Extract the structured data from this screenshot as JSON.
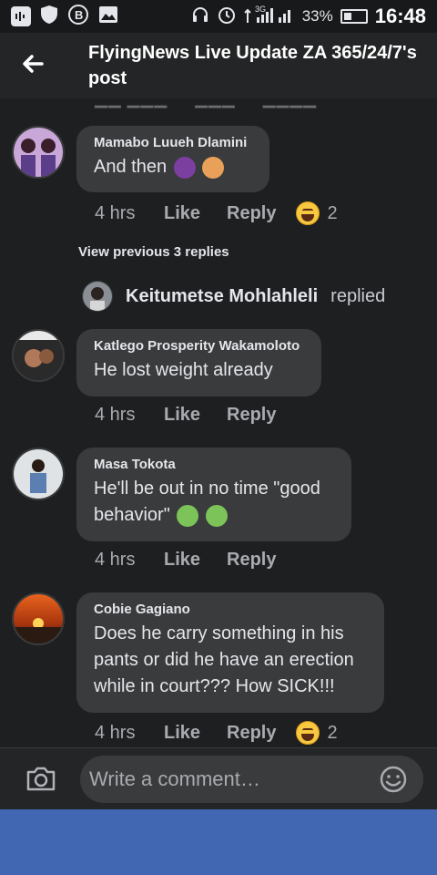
{
  "status_bar": {
    "network": "3G",
    "battery": "33%",
    "time": "16:48"
  },
  "header": {
    "title": "FlyingNews Live Update ZA 365/24/7's post"
  },
  "comments": [
    {
      "author": "Mamabo Luueh Dlamini",
      "text": "And then",
      "time": "4 hrs",
      "like": "Like",
      "reply": "Reply",
      "reaction_count": "2",
      "avatar_icon": "profile-photo"
    }
  ],
  "view_previous": "View previous 3 replies",
  "reply_thread": {
    "name": "Keitumetse Mohlahleli",
    "verb": "replied",
    "replies": [
      {
        "author": "Katlego Prosperity Wakamoloto",
        "text": "He lost weight already",
        "time": "4 hrs",
        "like": "Like",
        "reply": "Reply"
      },
      {
        "author": "Masa Tokota",
        "text": "He'll be out in no time \"good behavior\"",
        "time": "4 hrs",
        "like": "Like",
        "reply": "Reply"
      },
      {
        "author": "Cobie Gagiano",
        "text": "Does he carry something in his pants or did he have an erection while in court??? How SICK!!!",
        "time": "4 hrs",
        "like": "Like",
        "reply": "Reply",
        "reaction_count": "2"
      }
    ]
  },
  "composer": {
    "placeholder": "Write a comment…"
  },
  "colors": {
    "background": "#1e1f21",
    "bubble": "#3a3b3c",
    "nav": "#4267b2"
  }
}
